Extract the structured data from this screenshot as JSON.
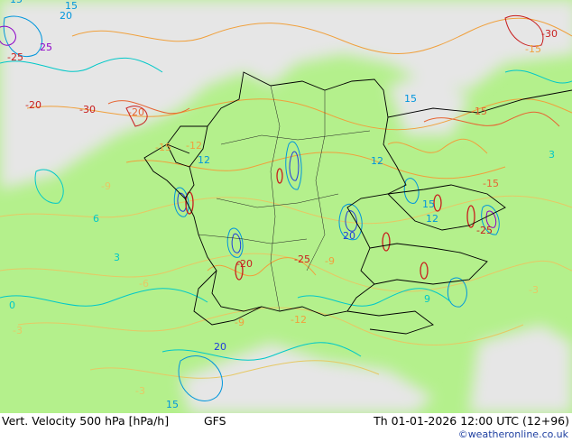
{
  "footer": {
    "title": "Vert. Velocity 500 hPa [hPa/h]",
    "model": "GFS",
    "valid_time": "Th 01-01-2026 12:00 UTC (12+96)",
    "credit": "©weatheronline.co.uk"
  },
  "colors": {
    "positive_area": "#b4f08c",
    "negative_area": "#e6e6e6",
    "positive_contours": [
      "#00c8c8",
      "#0096dc",
      "#1e3cdc",
      "#8c00c8"
    ],
    "negative_contours": [
      "#e6c864",
      "#f0a03c",
      "#e66432",
      "#c81e1e"
    ],
    "border": "#000000"
  },
  "contour_labels": [
    {
      "text": "15",
      "color": "#0096dc"
    },
    {
      "text": "20",
      "color": "#0096dc"
    },
    {
      "text": "25",
      "color": "#8c00c8"
    },
    {
      "text": "-25",
      "color": "#c81e1e"
    },
    {
      "text": "-30",
      "color": "#c81e1e"
    },
    {
      "text": "-20",
      "color": "#e66432"
    },
    {
      "text": "-15",
      "color": "#f0a03c"
    },
    {
      "text": "-12",
      "color": "#f0a03c"
    },
    {
      "text": "12",
      "color": "#0096dc"
    },
    {
      "text": "15",
      "color": "#0096dc"
    },
    {
      "text": "-9",
      "color": "#e6c864"
    },
    {
      "text": "6",
      "color": "#00c8c8"
    },
    {
      "text": "3",
      "color": "#00c8c8"
    },
    {
      "text": "0",
      "color": "#00c8c8"
    },
    {
      "text": "-6",
      "color": "#e6c864"
    },
    {
      "text": "-3",
      "color": "#e6c864"
    },
    {
      "text": "20",
      "color": "#1e3cdc"
    },
    {
      "text": "-20",
      "color": "#c81e1e"
    },
    {
      "text": "-25",
      "color": "#c81e1e"
    },
    {
      "text": "20",
      "color": "#1e3cdc"
    },
    {
      "text": "15",
      "color": "#0096dc"
    },
    {
      "text": "-15",
      "color": "#e66432"
    },
    {
      "text": "12",
      "color": "#0096dc"
    },
    {
      "text": "-9",
      "color": "#f0a03c"
    },
    {
      "text": "-12",
      "color": "#f0a03c"
    },
    {
      "text": "9",
      "color": "#00c8c8"
    },
    {
      "text": "-3",
      "color": "#e6c864"
    },
    {
      "text": "-20",
      "color": "#c81e1e"
    },
    {
      "text": "15",
      "color": "#0096dc"
    },
    {
      "text": "-15",
      "color": "#e66432"
    },
    {
      "text": "-25",
      "color": "#c81e1e"
    },
    {
      "text": "-30",
      "color": "#c81e1e"
    },
    {
      "text": "-15",
      "color": "#f0a03c"
    },
    {
      "text": "12",
      "color": "#0096dc"
    },
    {
      "text": "-9",
      "color": "#f0a03c"
    },
    {
      "text": "-3",
      "color": "#e6c864"
    },
    {
      "text": "3",
      "color": "#00c8c8"
    },
    {
      "text": "15",
      "color": "#0096dc"
    }
  ]
}
